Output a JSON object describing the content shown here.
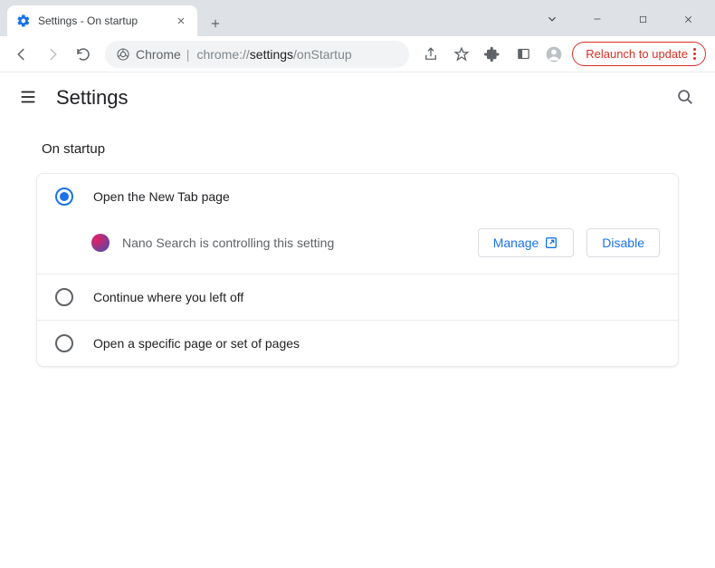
{
  "window": {
    "tab_title": "Settings - On startup"
  },
  "toolbar": {
    "site_label": "Chrome",
    "url_prefix": "chrome://",
    "url_bold": "settings",
    "url_suffix": "/onStartup",
    "update_label": "Relaunch to update"
  },
  "settings": {
    "title": "Settings",
    "section": "On startup",
    "options": [
      {
        "label": "Open the New Tab page",
        "selected": true
      },
      {
        "label": "Continue where you left off",
        "selected": false
      },
      {
        "label": "Open a specific page or set of pages",
        "selected": false
      }
    ],
    "extension": {
      "message": "Nano Search is controlling this setting",
      "manage_label": "Manage",
      "disable_label": "Disable"
    }
  }
}
